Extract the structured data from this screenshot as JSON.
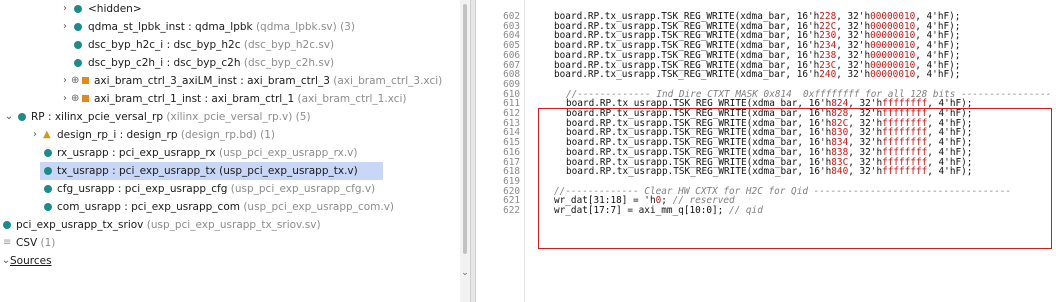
{
  "tree": {
    "items": [
      {
        "label": "<hidden>",
        "sub": ""
      },
      {
        "label": "qdma_st_lpbk_inst : qdma_lpbk",
        "sub": " (qdma_lpbk.sv) (3)"
      },
      {
        "label": "dsc_byp_h2c_i : dsc_byp_h2c",
        "sub": " (dsc_byp_h2c.sv)"
      },
      {
        "label": "dsc_byp_c2h_i : dsc_byp_c2h",
        "sub": " (dsc_byp_c2h.sv)"
      },
      {
        "label": "axi_bram_ctrl_3_axiLM_inst : axi_bram_ctrl_3",
        "sub": " (axi_bram_ctrl_3.xci)"
      },
      {
        "label": "axi_bram_ctrl_1_inst : axi_bram_ctrl_1",
        "sub": " (axi_bram_ctrl_1.xci)"
      },
      {
        "label": "RP : xilinx_pcie_versal_rp",
        "sub": " (xilinx_pcie_versal_rp.v) (5)"
      },
      {
        "label": "design_rp_i : design_rp",
        "sub": " (design_rp.bd) (1)"
      },
      {
        "label": "rx_usrapp : pci_exp_usrapp_rx",
        "sub": " (usp_pci_exp_usrapp_rx.v)"
      },
      {
        "label": "tx_usrapp : pci_exp_usrapp_tx",
        "sub": " (usp_pci_exp_usrapp_tx.v)"
      },
      {
        "label": "cfg_usrapp : pci_exp_usrapp_cfg",
        "sub": " (usp_pci_exp_usrapp_cfg.v)"
      },
      {
        "label": "com_usrapp : pci_exp_usrapp_com",
        "sub": " (usp_pci_exp_usrapp_com.v)"
      },
      {
        "label": "pci_exp_usrapp_tx_sriov",
        "sub": " (usp_pci_exp_usrapp_tx_sriov.sv)"
      },
      {
        "label": "CSV",
        "sub": " (1)"
      },
      {
        "label": "Sources",
        "sub": ""
      }
    ]
  },
  "code": {
    "lines": [
      {
        "n": "602",
        "a": "board.RP.tx_usrapp.TSK_REG_WRITE(xdma_bar, 16'h",
        "n1": "228",
        "b": ", 32'h",
        "n2": "00000010",
        "c": ", 4'hF);"
      },
      {
        "n": "603",
        "a": "board.RP.tx_usrapp.TSK_REG_WRITE(xdma_bar, 16'h",
        "n1": "22C",
        "b": ", 32'h",
        "n2": "00000010",
        "c": ", 4'hF);"
      },
      {
        "n": "604",
        "a": "board.RP.tx_usrapp.TSK_REG_WRITE(xdma_bar, 16'h",
        "n1": "230",
        "b": ", 32'h",
        "n2": "00000010",
        "c": ", 4'hF);"
      },
      {
        "n": "605",
        "a": "board.RP.tx_usrapp.TSK_REG_WRITE(xdma_bar, 16'h",
        "n1": "234",
        "b": ", 32'h",
        "n2": "00000010",
        "c": ", 4'hF);"
      },
      {
        "n": "606",
        "a": "board.RP.tx_usrapp.TSK_REG_WRITE(xdma_bar, 16'h",
        "n1": "238",
        "b": ", 32'h",
        "n2": "00000010",
        "c": ", 4'hF);"
      },
      {
        "n": "607",
        "a": "board.RP.tx_usrapp.TSK_REG_WRITE(xdma_bar, 16'h",
        "n1": "23C",
        "b": ", 32'h",
        "n2": "00000010",
        "c": ", 4'hF);"
      },
      {
        "n": "608",
        "a": "board.RP.tx_usrapp.TSK_REG_WRITE(xdma_bar, 16'h",
        "n1": "240",
        "b": ", 32'h",
        "n2": "00000010",
        "c": ", 4'hF);"
      },
      {
        "n": "609",
        "a": "",
        "n1": "",
        "b": "",
        "n2": "",
        "c": ""
      },
      {
        "n": "610",
        "cm": "//------------- Ind Dire CTXT MASK 0x814  0xffffffff for all 128 bits ----------------"
      },
      {
        "n": "611",
        "a": "board.RP.tx_usrapp.TSK_REG_WRITE(xdma_bar, 16'h",
        "n1": "824",
        "b": ", 32'h",
        "n2": "ffffffff",
        "c": ", 4'hF);"
      },
      {
        "n": "612",
        "a": "board.RP.tx_usrapp.TSK_REG_WRITE(xdma_bar, 16'h",
        "n1": "828",
        "b": ", 32'h",
        "n2": "ffffffff",
        "c": ", 4'hF);"
      },
      {
        "n": "613",
        "a": "board.RP.tx_usrapp.TSK_REG_WRITE(xdma_bar, 16'h",
        "n1": "82C",
        "b": ", 32'h",
        "n2": "ffffffff",
        "c": ", 4'hF);"
      },
      {
        "n": "614",
        "a": "board.RP.tx_usrapp.TSK_REG_WRITE(xdma_bar, 16'h",
        "n1": "830",
        "b": ", 32'h",
        "n2": "ffffffff",
        "c": ", 4'hF);"
      },
      {
        "n": "615",
        "a": "board.RP.tx_usrapp.TSK_REG_WRITE(xdma_bar, 16'h",
        "n1": "834",
        "b": ", 32'h",
        "n2": "ffffffff",
        "c": ", 4'hF);"
      },
      {
        "n": "616",
        "a": "board.RP.tx_usrapp.TSK_REG_WRITE(xdma_bar, 16'h",
        "n1": "838",
        "b": ", 32'h",
        "n2": "ffffffff",
        "c": ", 4'hF);"
      },
      {
        "n": "617",
        "a": "board.RP.tx_usrapp.TSK_REG_WRITE(xdma_bar, 16'h",
        "n1": "83C",
        "b": ", 32'h",
        "n2": "ffffffff",
        "c": ", 4'hF);"
      },
      {
        "n": "618",
        "a": "board.RP.tx_usrapp.TSK_REG_WRITE(xdma_bar, 16'h",
        "n1": "840",
        "b": ", 32'h",
        "n2": "ffffffff",
        "c": ", 4'hF);"
      },
      {
        "n": "619",
        "a": "",
        "n1": "",
        "b": "",
        "n2": "",
        "c": ""
      },
      {
        "n": "620",
        "cm": "//------------- Clear HW CXTX for H2C for Qid -----------------------------------"
      },
      {
        "n": "621",
        "a": "wr_dat[31:18] = 'h",
        "n1": "0",
        "b": "; ",
        "n2": "",
        "c": "",
        "cm2": "// reserved"
      },
      {
        "n": "622",
        "a": "wr_dat[17:7] = axi_mm_q[10:0]; ",
        "n1": "",
        "b": "",
        "n2": "",
        "c": "",
        "cm2": "// qid"
      }
    ]
  },
  "colors": {
    "highlight_border": "#c9201e",
    "selection": "#c7d7f5",
    "number": "#c71a1a",
    "module_dot": "#1f8a8a"
  }
}
